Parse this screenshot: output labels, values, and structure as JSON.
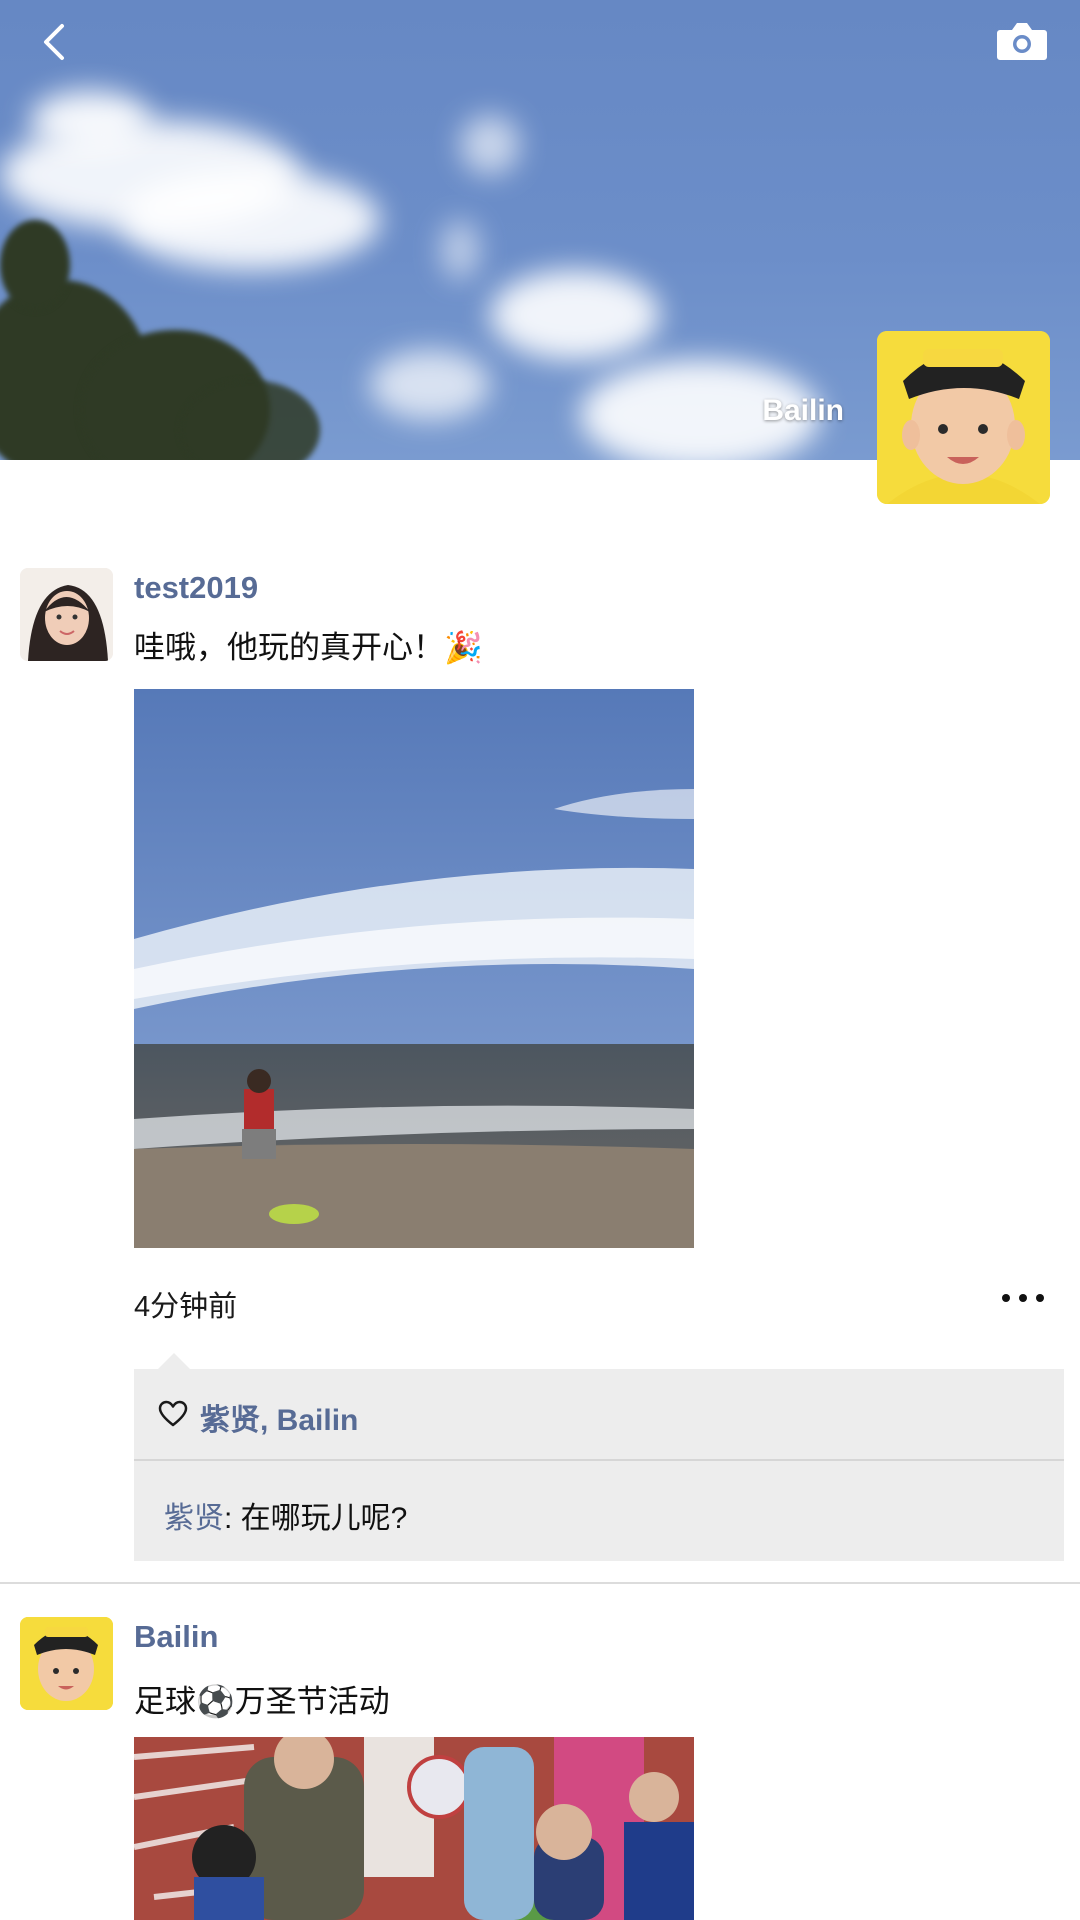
{
  "header": {
    "back_icon": "chevron-left-icon",
    "camera_icon": "camera-icon",
    "cover_name": "Bailin"
  },
  "posts": [
    {
      "username": "test2019",
      "text": "哇哦，他玩的真开心！🎉",
      "time": "4分钟前",
      "more_icon": "more-dots-icon",
      "likes_icon": "heart-icon",
      "likes": "紫贤, Bailin",
      "comments": [
        {
          "author": "紫贤",
          "separator": ": ",
          "text": "在哪玩儿呢?"
        }
      ]
    },
    {
      "username": "Bailin",
      "text": "足球⚽万圣节活动"
    }
  ],
  "colors": {
    "link_blue": "#576b95",
    "comment_bg": "#ededed",
    "sky": "#6a8cc8"
  }
}
